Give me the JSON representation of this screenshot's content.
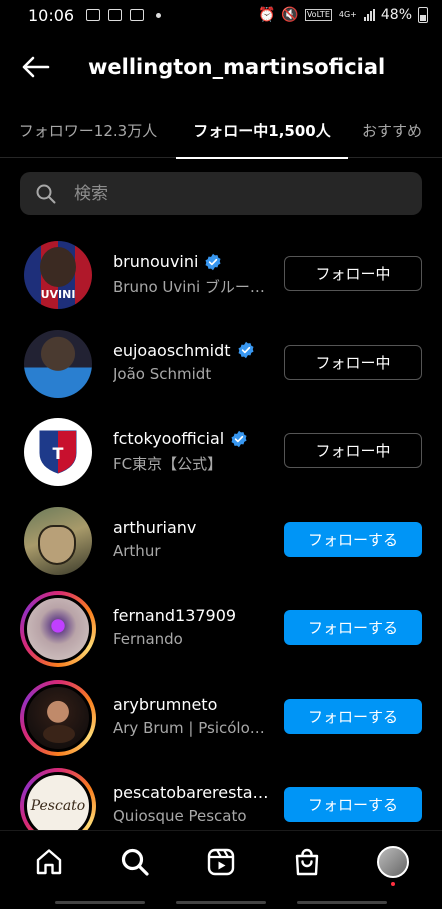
{
  "status_bar": {
    "time": "10:06",
    "battery": "48%",
    "network": "4G+",
    "volte": "VoLTE"
  },
  "header": {
    "title": "wellington_martinsoficial",
    "back_icon": "arrow-left-icon"
  },
  "tabs": [
    {
      "label": "フォロワー12.3万人",
      "active": false
    },
    {
      "label": "フォロー中1,500人",
      "active": true
    },
    {
      "label": "おすすめ",
      "active": false
    }
  ],
  "search": {
    "placeholder": "検索"
  },
  "users": [
    {
      "username": "brunouvini",
      "fullname": "Bruno Uvini ブルー…",
      "verified": true,
      "story_ring": false,
      "button": "フォロー中",
      "button_state": "following",
      "avatar_text": "UVINI"
    },
    {
      "username": "eujoaoschmidt",
      "fullname": "João Schmidt",
      "verified": true,
      "story_ring": false,
      "button": "フォロー中",
      "button_state": "following"
    },
    {
      "username": "fctokyoofficial",
      "fullname": "FC東京【公式】",
      "verified": true,
      "story_ring": false,
      "button": "フォロー中",
      "button_state": "following"
    },
    {
      "username": "arthurianv",
      "fullname": "Arthur",
      "verified": false,
      "story_ring": false,
      "button": "フォローする",
      "button_state": "follow"
    },
    {
      "username": "fernand137909",
      "fullname": "Fernando",
      "verified": false,
      "story_ring": true,
      "button": "フォローする",
      "button_state": "follow"
    },
    {
      "username": "arybrumneto",
      "fullname": "Ary Brum | Psicólo…",
      "verified": false,
      "story_ring": true,
      "button": "フォローする",
      "button_state": "follow"
    },
    {
      "username": "pescatobarerestau…",
      "fullname": "Quiosque Pescato",
      "verified": false,
      "story_ring": true,
      "button": "フォローする",
      "button_state": "follow",
      "avatar_text": "Pescato"
    }
  ],
  "bottom_nav": [
    {
      "icon": "home-icon"
    },
    {
      "icon": "search-icon"
    },
    {
      "icon": "reels-icon"
    },
    {
      "icon": "shop-icon"
    },
    {
      "icon": "profile-avatar"
    }
  ],
  "colors": {
    "background": "#000000",
    "follow_button": "#0095f6",
    "verified": "#3897f0",
    "secondary_text": "#a8a8a8",
    "search_bg": "#262626"
  }
}
